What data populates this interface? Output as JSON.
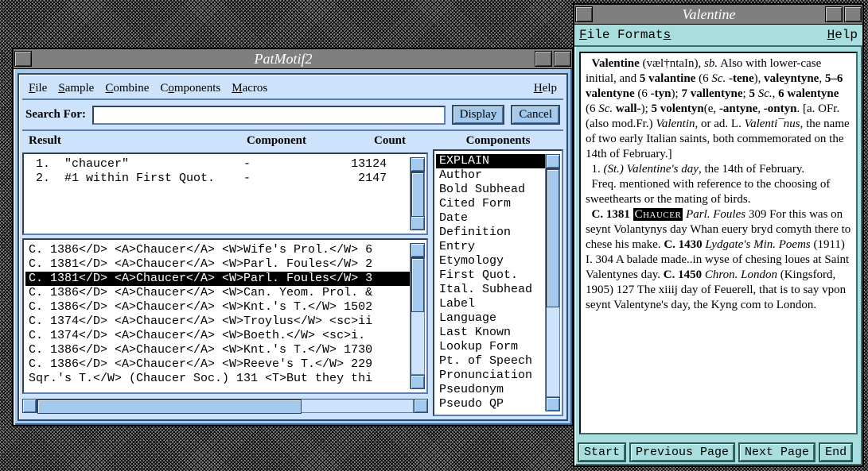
{
  "pm": {
    "title": "PatMotif2",
    "menu": {
      "file": "File",
      "sample": "Sample",
      "combine": "Combine",
      "components": "Components",
      "macros": "Macros",
      "help": "Help"
    },
    "search": {
      "label": "Search For:",
      "value": "",
      "display": "Display",
      "cancel": "Cancel"
    },
    "headers": {
      "result": "Result",
      "component": "Component",
      "count": "Count",
      "components": "Components"
    },
    "results": [
      {
        "idx": "1.",
        "text": "\"chaucer\"",
        "component": "-",
        "count": "13124"
      },
      {
        "idx": "2.",
        "text": "#1 within First Quot.",
        "component": "-",
        "count": "2147"
      }
    ],
    "results_selected": -1,
    "concordance": [
      "C. 1386</D> <A>Chaucer</A> <W>Wife's Prol.</W> 6",
      "C. 1381</D> <A>Chaucer</A> <W>Parl. Foules</W> 2",
      "C. 1381</D> <A>Chaucer</A> <W>Parl. Foules</W> 3",
      "C. 1386</D> <A>Chaucer</A> <W>Can. Yeom. Prol. &",
      "C. 1386</D> <A>Chaucer</A> <W>Knt.'s T.</W> 1502",
      "C. 1374</D> <A>Chaucer</A> <W>Troylus</W> <sc>ii",
      "C. 1374</D> <A>Chaucer</A> <W>Boeth.</W> <sc>i.",
      "C. 1386</D> <A>Chaucer</A> <W>Knt.'s T.</W> 1730",
      "C. 1386</D> <A>Chaucer</A> <W>Reeve's T.</W> 229",
      "Sqr.'s T.</W> (Chaucer Soc.) 131 <T>But they thi"
    ],
    "concordance_selected": 2,
    "components": [
      "EXPLAIN",
      "Author",
      "Bold Subhead",
      "Cited Form",
      "Date",
      "Definition",
      "Entry",
      "Etymology",
      "First Quot.",
      "Ital. Subhead",
      "Label",
      "Language",
      "Last Known",
      "Lookup Form",
      "Pt. of Speech",
      "Pronunciation",
      "Pseudonym",
      "Pseudo QP"
    ],
    "components_selected": 0
  },
  "val": {
    "title": "Valentine",
    "menu": {
      "file": "File",
      "formats": "Formats",
      "help": "Help"
    },
    "entry": {
      "headword": "Valentine",
      "pron": "(væl†ntaIn)",
      "pos_abbr": "sb.",
      "forms_intro": " Also with lower-case initial, and ",
      "f1": "5 valantine",
      "f1p": " (6 ",
      "f1i": "Sc.",
      "f1b": " -tene",
      "f2": "valeyntyne",
      "f3": "5–6 valentyne",
      "f3p": " (6 ",
      "f3b": "-tyn",
      "f4": "7 vallentyne",
      "f5a": "5 ",
      "f5i": "Sc.",
      "f5b": "6 walentyne",
      "f5p": " (6 ",
      "f5ii": "Sc.",
      "f5bb": " wall-",
      "f6": "5 volentyn",
      "f6p": "(e, ",
      "f6b": "-antyne",
      "f6c": "-ontyn",
      "ety_open": ". [a. OFr. (also mod.Fr.) ",
      "ety_it1": "Valentin",
      "ety_mid": ", or ad. L. ",
      "ety_it2": "Valenti¯nus",
      "ety_rest": ", the name of two early Italian saints, both commemorated on the 14th of February.]",
      "sense1_num": "1.",
      "sense1_it": "(St.) Valentine's day",
      "sense1_rest": ", the 14th of February.",
      "freq": "Freq. mentioned with reference to the choosing of sweethearts or the mating of birds.",
      "q1_date": "C. 1381",
      "q1_author": "Chaucer",
      "q1_title": "Parl. Foules",
      "q1_loc": " 309 ",
      "q1_text": "For this was on seynt Volantynys day Whan euery bryd comyth there to chese his make. ",
      "q2_date": "C. 1430",
      "q2_title": "Lydgate's Min. Poems",
      "q2_paren": " (1911) I. 304 ",
      "q2_text": "A balade made..in wyse of chesing loues at Saint Valentynes day. ",
      "q3_date": "C. 1450",
      "q3_title": "Chron. London",
      "q3_paren": " (Kingsford, 1905) 127 ",
      "q3_text": "The xiiij day of Feuerell, that is to say vpon seynt Valentyne's day, the Kyng com to London."
    },
    "footer": {
      "start": "Start",
      "prev": "Previous Page",
      "next": "Next Page",
      "end": "End"
    }
  }
}
